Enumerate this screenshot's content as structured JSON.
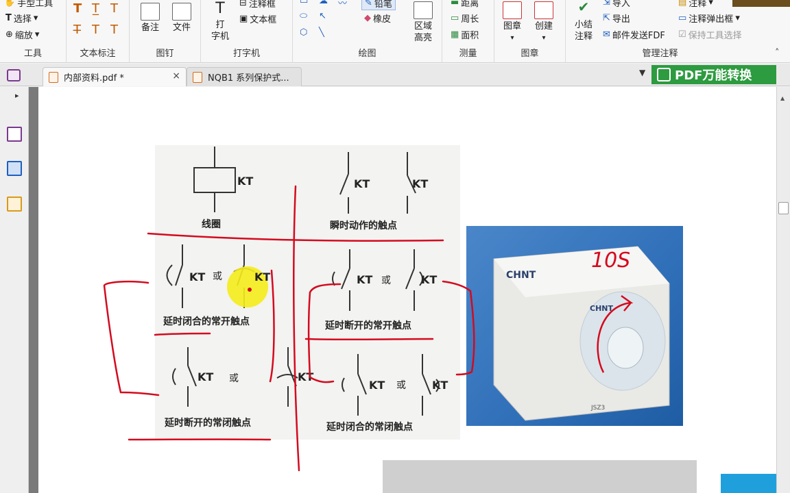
{
  "ribbon": {
    "groups": [
      {
        "label": "工具",
        "items": [
          "手型工具",
          "选择",
          "缩放"
        ]
      },
      {
        "label": "文本标注"
      },
      {
        "label": "图钉",
        "items": [
          "备注",
          "文件"
        ]
      },
      {
        "label": "打字机",
        "items": [
          "打\n字机",
          "注释框",
          "文本框"
        ]
      },
      {
        "label": "绘图",
        "items": [
          "铅笔",
          "橡皮",
          "区域\n高亮"
        ]
      },
      {
        "label": "测量",
        "items": [
          "距离",
          "周长",
          "面积"
        ]
      },
      {
        "label": "图章",
        "items": [
          "图章",
          "创建"
        ]
      },
      {
        "label": "管理注释",
        "items": [
          "小结\n注释",
          "导入",
          "导出",
          "邮件发送FDF",
          "注释",
          "注释弹出框",
          "保持工具选择"
        ]
      }
    ]
  },
  "tabs": [
    {
      "label": "内部资料.pdf *",
      "close": "×",
      "active": true
    },
    {
      "label": "NQB1 系列保护式...",
      "active": false
    }
  ],
  "promo": {
    "label": "PDF万能转换"
  },
  "diagram": {
    "labels": {
      "coil_symbol": "KT",
      "coil_caption": "线圈",
      "instant_caption": "瞬时动作的触点",
      "delay_close_no_caption": "延时闭合的常开触点",
      "delay_open_no_caption": "延时断开的常开触点",
      "delay_open_nc_caption": "延时断开的常闭触点",
      "delay_close_nc_caption": "延时闭合的常闭触点",
      "or_word": "或",
      "kt": "KT"
    }
  },
  "photo": {
    "brand": "CHNT",
    "model": "JSZ3",
    "handwritten_note": "10S"
  },
  "colors": {
    "ribbon_bg": "#f7f7f7",
    "promo_green": "#2d9b3f",
    "annotation_red": "#d40a1e",
    "highlight_yellow": "#f5ec1a",
    "photo_blue": "#2f6fb8"
  }
}
